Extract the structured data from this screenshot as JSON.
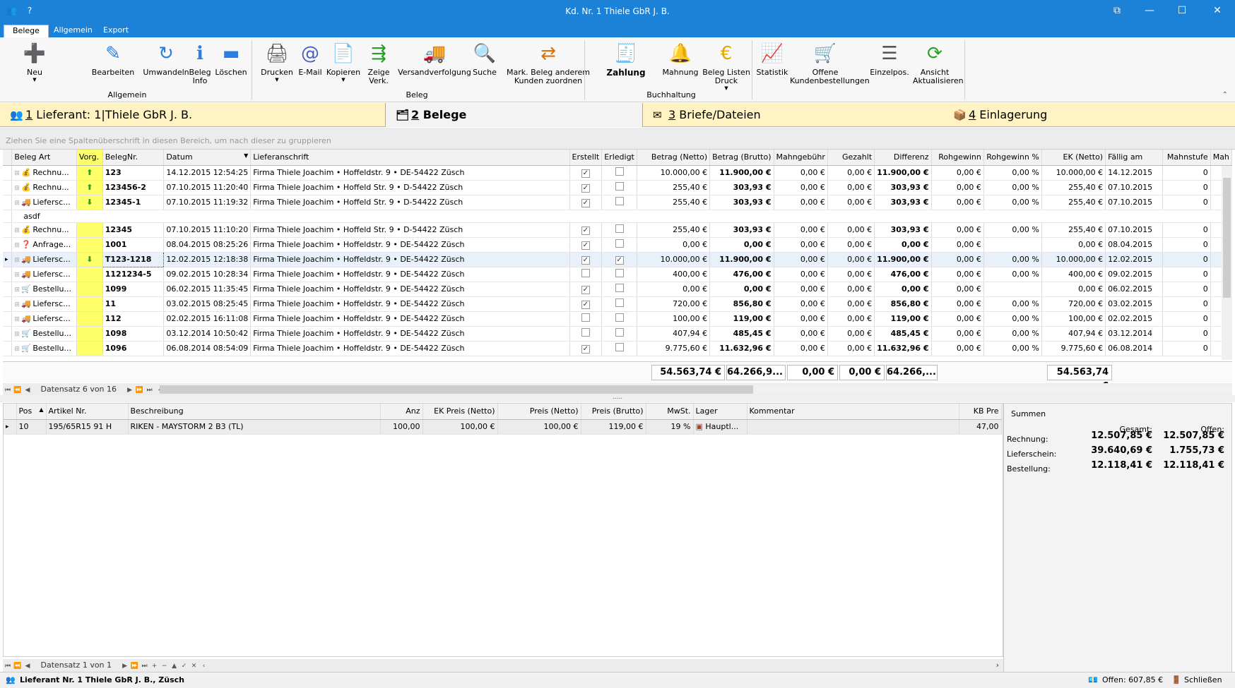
{
  "window": {
    "title": "Kd. Nr. 1 Thiele GbR J. B."
  },
  "ribbon": {
    "tabs": [
      "Belege",
      "Allgemein",
      "Export"
    ],
    "buttons": [
      {
        "label": "Neu",
        "icon": "new-icon",
        "dropdown": true
      },
      {
        "label": "Bearbeiten",
        "icon": "pencil-icon"
      },
      {
        "label": "Umwandeln",
        "icon": "convert-icon"
      },
      {
        "label": "Beleg\nInfo",
        "icon": "info-icon"
      },
      {
        "label": "Löschen",
        "icon": "delete-icon"
      },
      {
        "label": "Drucken",
        "icon": "printer-icon",
        "dropdown": true
      },
      {
        "label": "E-Mail",
        "icon": "email-icon"
      },
      {
        "label": "Kopieren",
        "icon": "copy-icon",
        "dropdown": true
      },
      {
        "label": "Zeige\nVerk.",
        "icon": "link-icon"
      },
      {
        "label": "Versandverfolgung",
        "icon": "truck-icon"
      },
      {
        "label": "Suche",
        "icon": "search-icon"
      },
      {
        "label": "Mark. Beleg  anderem\nKunden zuordnen",
        "icon": "assign-icon"
      },
      {
        "label": "Zahlung",
        "icon": "cash-register-icon"
      },
      {
        "label": "Mahnung",
        "icon": "reminder-icon"
      },
      {
        "label": "Beleg Listen\nDruck",
        "icon": "euro-icon",
        "dropdown": true
      },
      {
        "label": "Statistik",
        "icon": "chart-icon"
      },
      {
        "label": "Offene\nKundenbestellungen",
        "icon": "cart-icon"
      },
      {
        "label": "Einzelpos.",
        "icon": "list-icon"
      },
      {
        "label": "Ansicht\nAktualisieren",
        "icon": "refresh-icon"
      }
    ],
    "groups": [
      "Allgemein",
      "Beleg",
      "Buchhaltung"
    ]
  },
  "section_tabs": [
    {
      "num": "1",
      "label": "Lieferant: 1|Thiele GbR J. B.",
      "icon": "people-icon"
    },
    {
      "num": "2",
      "label": "Belege",
      "icon": "documents-icon"
    },
    {
      "num": "3",
      "label": "Briefe/Dateien",
      "icon": "envelope-icon"
    },
    {
      "num": "4",
      "label": "Einlagerung",
      "icon": "boxes-icon"
    }
  ],
  "group_panel_hint": "Ziehen Sie eine Spaltenüberschrift in diesen Bereich, um nach dieser zu gruppieren",
  "grid": {
    "headers": [
      "Beleg Art",
      "Vorg.",
      "BelegNr.",
      "Datum",
      "Lieferanschrift",
      "Erstellt",
      "Erledigt",
      "Betrag (Netto)",
      "Betrag (Brutto)",
      "Mahngebühr",
      "Gezahlt",
      "Differenz",
      "Rohgewinn",
      "Rohgewinn %",
      "EK (Netto)",
      "Fällig am",
      "Mahnstufe",
      "Mah"
    ],
    "rows": [
      {
        "art": "Rechnu...",
        "vorg": "up",
        "nr": "123",
        "datum": "14.12.2015 12:54:25",
        "anschrift": "Firma Thiele Joachim • Hoffeldstr. 9 • DE-54422 Züsch",
        "erstellt": true,
        "erledigt": false,
        "netto": "10.000,00 €",
        "brutto": "11.900,00 €",
        "mahn": "0,00 €",
        "gezahlt": "0,00 €",
        "diff": "11.900,00 €",
        "roh": "0,00 €",
        "rohp": "0,00 %",
        "ek": "10.000,00 €",
        "faellig": "14.12.2015",
        "stufe": "0"
      },
      {
        "art": "Rechnu...",
        "vorg": "up",
        "nr": "123456-2",
        "datum": "07.10.2015 11:20:40",
        "anschrift": "Firma Thiele Joachim • Hoffeld Str. 9 • D-54422 Züsch",
        "erstellt": true,
        "erledigt": false,
        "netto": "255,40 €",
        "brutto": "303,93 €",
        "mahn": "0,00 €",
        "gezahlt": "0,00 €",
        "diff": "303,93 €",
        "roh": "0,00 €",
        "rohp": "0,00 %",
        "ek": "255,40 €",
        "faellig": "07.10.2015",
        "stufe": "0"
      },
      {
        "art": "Liefersc...",
        "vorg": "down",
        "nr": "12345-1",
        "datum": "07.10.2015 11:19:32",
        "anschrift": "Firma Thiele Joachim • Hoffeld Str. 9 • D-54422 Züsch",
        "erstellt": true,
        "erledigt": false,
        "netto": "255,40 €",
        "brutto": "303,93 €",
        "mahn": "0,00 €",
        "gezahlt": "0,00 €",
        "diff": "303,93 €",
        "roh": "0,00 €",
        "rohp": "0,00 %",
        "ek": "255,40 €",
        "faellig": "07.10.2015",
        "stufe": "0"
      },
      {
        "note": "asdf"
      },
      {
        "art": "Rechnu...",
        "vorg": "",
        "nr": "12345",
        "datum": "07.10.2015 11:10:20",
        "anschrift": "Firma Thiele Joachim • Hoffeld Str. 9 • D-54422 Züsch",
        "erstellt": true,
        "erledigt": false,
        "netto": "255,40 €",
        "brutto": "303,93 €",
        "mahn": "0,00 €",
        "gezahlt": "0,00 €",
        "diff": "303,93 €",
        "roh": "0,00 €",
        "rohp": "0,00 %",
        "ek": "255,40 €",
        "faellig": "07.10.2015",
        "stufe": "0"
      },
      {
        "art": "Anfrage...",
        "vorg": "",
        "nr": "1001",
        "datum": "08.04.2015 08:25:26",
        "anschrift": "Firma Thiele Joachim • Hoffeldstr. 9 • DE-54422 Züsch",
        "erstellt": true,
        "erledigt": false,
        "netto": "0,00 €",
        "brutto": "0,00 €",
        "mahn": "0,00 €",
        "gezahlt": "0,00 €",
        "diff": "0,00 €",
        "roh": "0,00 €",
        "rohp": "",
        "ek": "0,00 €",
        "faellig": "08.04.2015",
        "stufe": "0"
      },
      {
        "art": "Liefersc...",
        "vorg": "down",
        "nr": "T123-1218",
        "datum": "12.02.2015 12:18:38",
        "anschrift": "Firma Thiele Joachim • Hoffeldstr. 9 • DE-54422 Züsch",
        "erstellt": true,
        "erledigt": true,
        "netto": "10.000,00 €",
        "brutto": "11.900,00 €",
        "mahn": "0,00 €",
        "gezahlt": "0,00 €",
        "diff": "11.900,00 €",
        "roh": "0,00 €",
        "rohp": "0,00 %",
        "ek": "10.000,00 €",
        "faellig": "12.02.2015",
        "stufe": "0",
        "selected": true
      },
      {
        "art": "Liefersc...",
        "vorg": "",
        "nr": "1121234-5",
        "datum": "09.02.2015 10:28:34",
        "anschrift": "Firma Thiele Joachim • Hoffeldstr. 9 • DE-54422 Züsch",
        "erstellt": false,
        "erledigt": false,
        "netto": "400,00 €",
        "brutto": "476,00 €",
        "mahn": "0,00 €",
        "gezahlt": "0,00 €",
        "diff": "476,00 €",
        "roh": "0,00 €",
        "rohp": "0,00 %",
        "ek": "400,00 €",
        "faellig": "09.02.2015",
        "stufe": "0"
      },
      {
        "art": "Bestellu...",
        "vorg": "",
        "nr": "1099",
        "datum": "06.02.2015 11:35:45",
        "anschrift": "Firma Thiele Joachim • Hoffeldstr. 9 • DE-54422 Züsch",
        "erstellt": true,
        "erledigt": false,
        "netto": "0,00 €",
        "brutto": "0,00 €",
        "mahn": "0,00 €",
        "gezahlt": "0,00 €",
        "diff": "0,00 €",
        "roh": "0,00 €",
        "rohp": "",
        "ek": "0,00 €",
        "faellig": "06.02.2015",
        "stufe": "0"
      },
      {
        "art": "Liefersc...",
        "vorg": "",
        "nr": "11",
        "datum": "03.02.2015 08:25:45",
        "anschrift": "Firma Thiele Joachim • Hoffeldstr. 9 • DE-54422 Züsch",
        "erstellt": true,
        "erledigt": false,
        "netto": "720,00 €",
        "brutto": "856,80 €",
        "mahn": "0,00 €",
        "gezahlt": "0,00 €",
        "diff": "856,80 €",
        "roh": "0,00 €",
        "rohp": "0,00 %",
        "ek": "720,00 €",
        "faellig": "03.02.2015",
        "stufe": "0"
      },
      {
        "art": "Liefersc...",
        "vorg": "",
        "nr": "112",
        "datum": "02.02.2015 16:11:08",
        "anschrift": "Firma Thiele Joachim • Hoffeldstr. 9 • DE-54422 Züsch",
        "erstellt": false,
        "erledigt": false,
        "netto": "100,00 €",
        "brutto": "119,00 €",
        "mahn": "0,00 €",
        "gezahlt": "0,00 €",
        "diff": "119,00 €",
        "roh": "0,00 €",
        "rohp": "0,00 %",
        "ek": "100,00 €",
        "faellig": "02.02.2015",
        "stufe": "0"
      },
      {
        "art": "Bestellu...",
        "vorg": "",
        "nr": "1098",
        "datum": "03.12.2014 10:50:42",
        "anschrift": "Firma Thiele Joachim • Hoffeldstr. 9 • DE-54422 Züsch",
        "erstellt": false,
        "erledigt": false,
        "netto": "407,94 €",
        "brutto": "485,45 €",
        "mahn": "0,00 €",
        "gezahlt": "0,00 €",
        "diff": "485,45 €",
        "roh": "0,00 €",
        "rohp": "0,00 %",
        "ek": "407,94 €",
        "faellig": "03.12.2014",
        "stufe": "0"
      },
      {
        "art": "Bestellu...",
        "vorg": "",
        "nr": "1096",
        "datum": "06.08.2014 08:54:09",
        "anschrift": "Firma Thiele Joachim • Hoffeldstr. 9 • DE-54422 Züsch",
        "erstellt": true,
        "erledigt": false,
        "netto": "9.775,60 €",
        "brutto": "11.632,96 €",
        "mahn": "0,00 €",
        "gezahlt": "0,00 €",
        "diff": "11.632,96 €",
        "roh": "0,00 €",
        "rohp": "0,00 %",
        "ek": "9.775,60 €",
        "faellig": "06.08.2014",
        "stufe": "0"
      }
    ],
    "totals": {
      "netto": "54.563,74 €",
      "brutto": "64.266,9...",
      "mahn": "0,00 €",
      "gezahlt": "0,00 €",
      "diff": "64.266,...",
      "ek": "54.563,74 €"
    },
    "navigator": "Datensatz 6 von 16"
  },
  "lower_grid": {
    "headers": [
      "Pos",
      "Artikel Nr.",
      "Beschreibung",
      "Anz",
      "EK Preis (Netto)",
      "Preis (Netto)",
      "Preis (Brutto)",
      "MwSt.",
      "Lager",
      "Kommentar",
      "KB Pre"
    ],
    "rows": [
      {
        "pos": "10",
        "artikel": "195/65R15 91 H",
        "beschreibung": "RIKEN - MAYSTORM 2 B3 (TL)",
        "anz": "100,00",
        "ek": "100,00 €",
        "netto": "100,00 €",
        "brutto": "119,00 €",
        "mwst": "19 %",
        "lager": "Hauptl...",
        "kommentar": "",
        "kb": "47,00"
      }
    ],
    "navigator": "Datensatz 1 von 1"
  },
  "summen": {
    "title": "Summen",
    "col_gesamt": "Gesamt:",
    "col_offen": "Offen:",
    "rows": [
      {
        "label": "Rechnung:",
        "gesamt": "12.507,85 €",
        "offen": "12.507,85 €"
      },
      {
        "label": "Lieferschein:",
        "gesamt": "39.640,69 €",
        "offen": "1.755,73 €"
      },
      {
        "label": "Bestellung:",
        "gesamt": "12.118,41 €",
        "offen": "12.118,41 €"
      }
    ]
  },
  "status": {
    "left": "Lieferant Nr. 1 Thiele GbR J. B., Züsch",
    "offen": "Offen: 607,85 €",
    "close": "Schließen"
  }
}
